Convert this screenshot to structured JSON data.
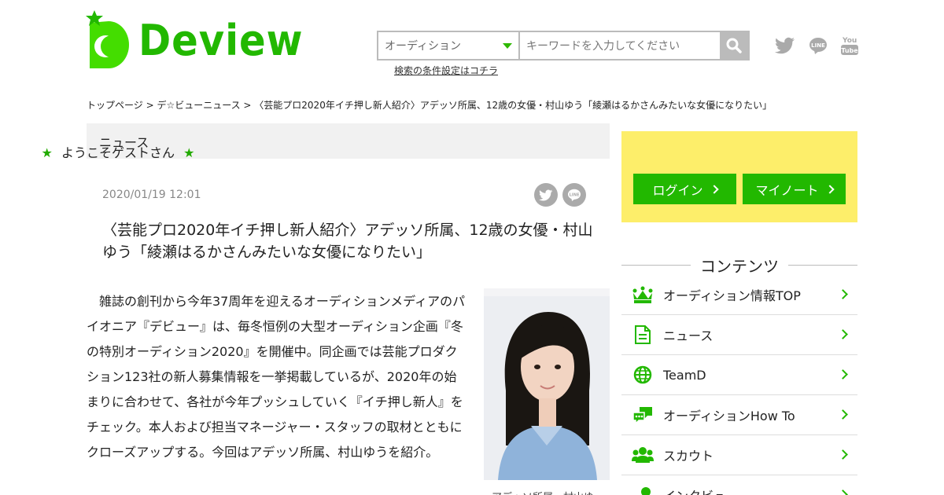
{
  "site": {
    "logo_text": "Deview"
  },
  "search": {
    "category_selected": "オーディション",
    "keyword_placeholder": "キーワードを入力してください",
    "condition_link": "検索の条件設定はコチラ"
  },
  "breadcrumb": "トップページ > デ☆ビューニュース > 〈芸能プロ2020年イチ押し新人紹介〉アデッソ所属、12歳の女優・村山ゆう「綾瀬はるかさんみたいな女優になりたい」",
  "article": {
    "section": "ニュース",
    "date": "2020/01/19 12:01",
    "title": "〈芸能プロ2020年イチ押し新人紹介〉アデッソ所属、12歳の女優・村山ゆう「綾瀬はるかさんみたいな女優になりたい」",
    "body": "雑誌の創刊から今年37周年を迎えるオーディションメディアのパイオニア『デビュー』は、毎冬恒例の大型オーディション企画『冬の特別オーディション2020』を開催中。同企画では芸能プロダクション123社の新人募集情報を一挙掲載しているが、2020年の始まりに合わせて、各社が今年プッシュしていく『イチ押し新人』をチェック。本人および担当マネージャー・スタッフの取材とともにクローズアップする。今回はアデッソ所属、村山ゆうを紹介。",
    "photo_caption": "アデッソ所属、村山ゆ"
  },
  "sidebar": {
    "welcome": "ようこそゲストさん",
    "star": "★",
    "login_label": "ログイン",
    "mynote_label": "マイノート",
    "contents_heading": "コンテンツ",
    "menu": [
      {
        "label": "オーディション情報TOP",
        "icon": "crown-icon"
      },
      {
        "label": "ニュース",
        "icon": "document-icon"
      },
      {
        "label": "TeamD",
        "icon": "globe-icon"
      },
      {
        "label": "オーディションHow To",
        "icon": "chat-icon"
      },
      {
        "label": "スカウト",
        "icon": "people-icon"
      },
      {
        "label": "インタビュー",
        "icon": "microphone-icon"
      }
    ]
  },
  "colors": {
    "brand_green": "#22b800",
    "welcome_yellow": "#fdee6a"
  }
}
